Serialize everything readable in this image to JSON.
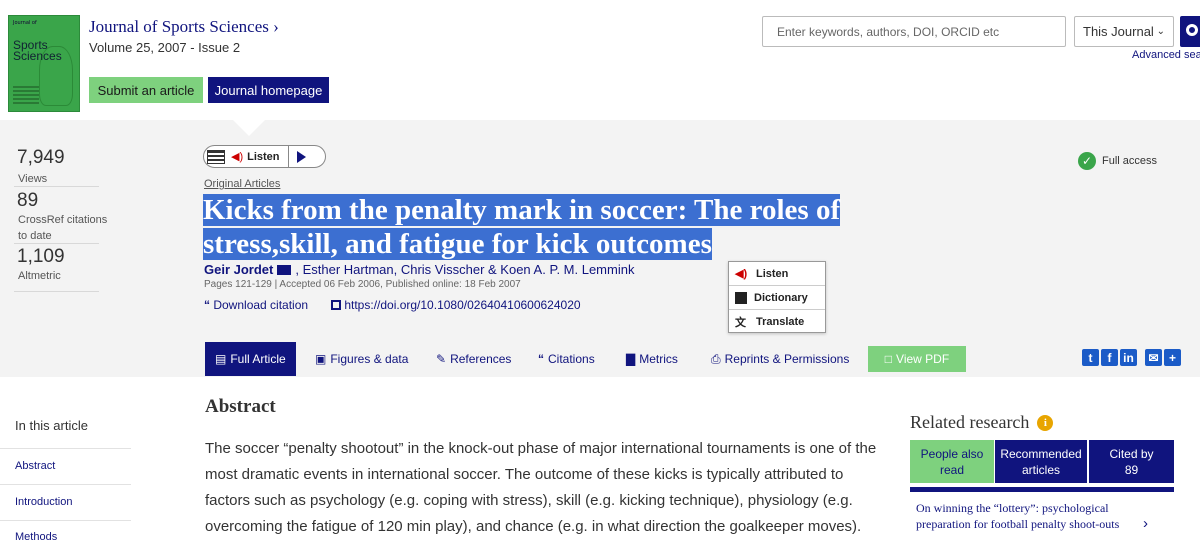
{
  "journal": {
    "title": "Journal of Sports Sciences",
    "title_suffix": "›",
    "volume_issue": "Volume 25, 2007 - Issue 2",
    "cover_title": "Sports Sciences",
    "cover_top": "Journal of",
    "submit_label": "Submit an article",
    "homepage_label": "Journal homepage"
  },
  "search": {
    "placeholder": "Enter keywords, authors, DOI, ORCID etc",
    "scope": "This Journal",
    "advanced": "Advanced sear"
  },
  "metrics": [
    {
      "value": "7,949",
      "label": "Views"
    },
    {
      "value": "89",
      "label": "CrossRef citations to date"
    },
    {
      "value": "1,109",
      "label": "Altmetric"
    }
  ],
  "listen": {
    "label": "Listen"
  },
  "access": {
    "label": "Full access"
  },
  "article": {
    "type": "Original Articles",
    "title_line1": "Kicks from the penalty mark in soccer: The roles of",
    "title_line2": "stress,skill, and fatigue for kick outcomes",
    "author_first": "Geir Jordet",
    "authors_rest": ", Esther Hartman, Chris Visscher & Koen A. P. M. Lemmink",
    "pages": "Pages 121-129 | Accepted 06 Feb 2006, Published online: 18 Feb 2007",
    "download_citation": "Download citation",
    "doi": "https://doi.org/10.1080/02640410600624020"
  },
  "popup": {
    "listen": "Listen",
    "dictionary": "Dictionary",
    "translate": "Translate"
  },
  "tabs": {
    "full_article": "Full Article",
    "figures": "Figures & data",
    "references": "References",
    "citations": "Citations",
    "metrics": "Metrics",
    "reprints": "Reprints & Permissions",
    "pdf": "View PDF"
  },
  "sidebar": {
    "title": "In this article",
    "items": [
      "Abstract",
      "Introduction",
      "Methods"
    ]
  },
  "abstract": {
    "heading": "Abstract",
    "text": "The soccer “penalty shootout” in the knock-out phase of major international tournaments is one of the most dramatic events in international soccer. The outcome of these kicks is typically attributed to factors such as psychology (e.g. coping with stress), skill (e.g. kicking technique), physiology (e.g. overcoming the fatigue of 120 min play), and chance (e.g. in what direction the goalkeeper moves)."
  },
  "related": {
    "heading": "Related research",
    "tab_people": "People also read",
    "tab_recommended": "Recommended articles",
    "tab_cited": "Cited by",
    "tab_cited_count": "89",
    "first_item": "On winning the “lottery”: psychological preparation for football penalty shoot-outs"
  },
  "colors": {
    "brand": "#10147e",
    "accent_green": "#7ed17e",
    "highlight": "#3c6fd1"
  }
}
